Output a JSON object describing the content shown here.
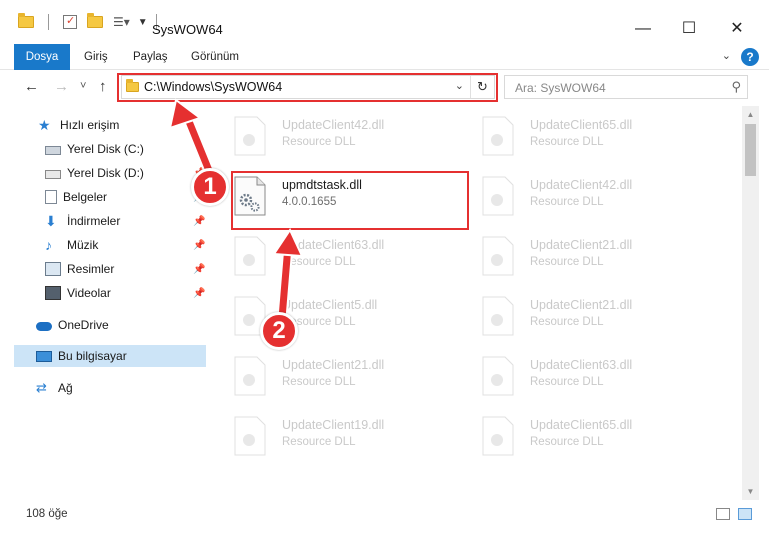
{
  "window": {
    "title": "SysWOW64",
    "minimize": "—",
    "maximize": "☐",
    "close": "✕"
  },
  "ribbon": {
    "tabs": [
      "Dosya",
      "Giriş",
      "Paylaş",
      "Görünüm"
    ],
    "help": "?"
  },
  "nav": {
    "back": "←",
    "forward": "→",
    "recent": "˅",
    "up": "↑",
    "address": "C:\\Windows\\SysWOW64",
    "search_placeholder": "Ara: SysWOW64"
  },
  "sidebar": {
    "items": [
      {
        "label": "Hızlı erişim",
        "icon": "star-icon"
      },
      {
        "label": "Yerel Disk (C:)",
        "icon": "drive-icon"
      },
      {
        "label": "Yerel Disk (D:)",
        "icon": "drive-icon"
      },
      {
        "label": "Belgeler",
        "icon": "documents-icon"
      },
      {
        "label": "İndirmeler",
        "icon": "downloads-icon"
      },
      {
        "label": "Müzik",
        "icon": "music-icon"
      },
      {
        "label": "Resimler",
        "icon": "pictures-icon"
      },
      {
        "label": "Videolar",
        "icon": "videos-icon"
      },
      {
        "label": "OneDrive",
        "icon": "cloud-icon"
      },
      {
        "label": "Bu bilgisayar",
        "icon": "computer-icon"
      },
      {
        "label": "Ağ",
        "icon": "network-icon"
      }
    ]
  },
  "files": [
    {
      "name": "UpdateClient42.dll",
      "sub": "Resource DLL"
    },
    {
      "name": "UpdateClient65.dll",
      "sub": "Resource DLL"
    },
    {
      "name": "upmdtstask.dll",
      "sub": "4.0.0.1655"
    },
    {
      "name": "UpdateClient42.dll",
      "sub": "Resource DLL"
    },
    {
      "name": "UpdateClient63.dll",
      "sub": "Resource DLL"
    },
    {
      "name": "UpdateClient21.dll",
      "sub": "Resource DLL"
    },
    {
      "name": "UpdateClient5.dll",
      "sub": "Resource DLL"
    },
    {
      "name": "UpdateClient21.dll",
      "sub": "Resource DLL"
    },
    {
      "name": "UpdateClient21.dll",
      "sub": "Resource DLL"
    },
    {
      "name": "UpdateClient63.dll",
      "sub": "Resource DLL"
    },
    {
      "name": "UpdateClient19.dll",
      "sub": "Resource DLL"
    },
    {
      "name": "UpdateClient65.dll",
      "sub": "Resource DLL"
    }
  ],
  "status": {
    "count": "108 öğe"
  },
  "callouts": {
    "one": "1",
    "two": "2"
  },
  "colors": {
    "accent": "#1979ca",
    "highlight": "#e53030",
    "selection": "#cce4f7"
  }
}
